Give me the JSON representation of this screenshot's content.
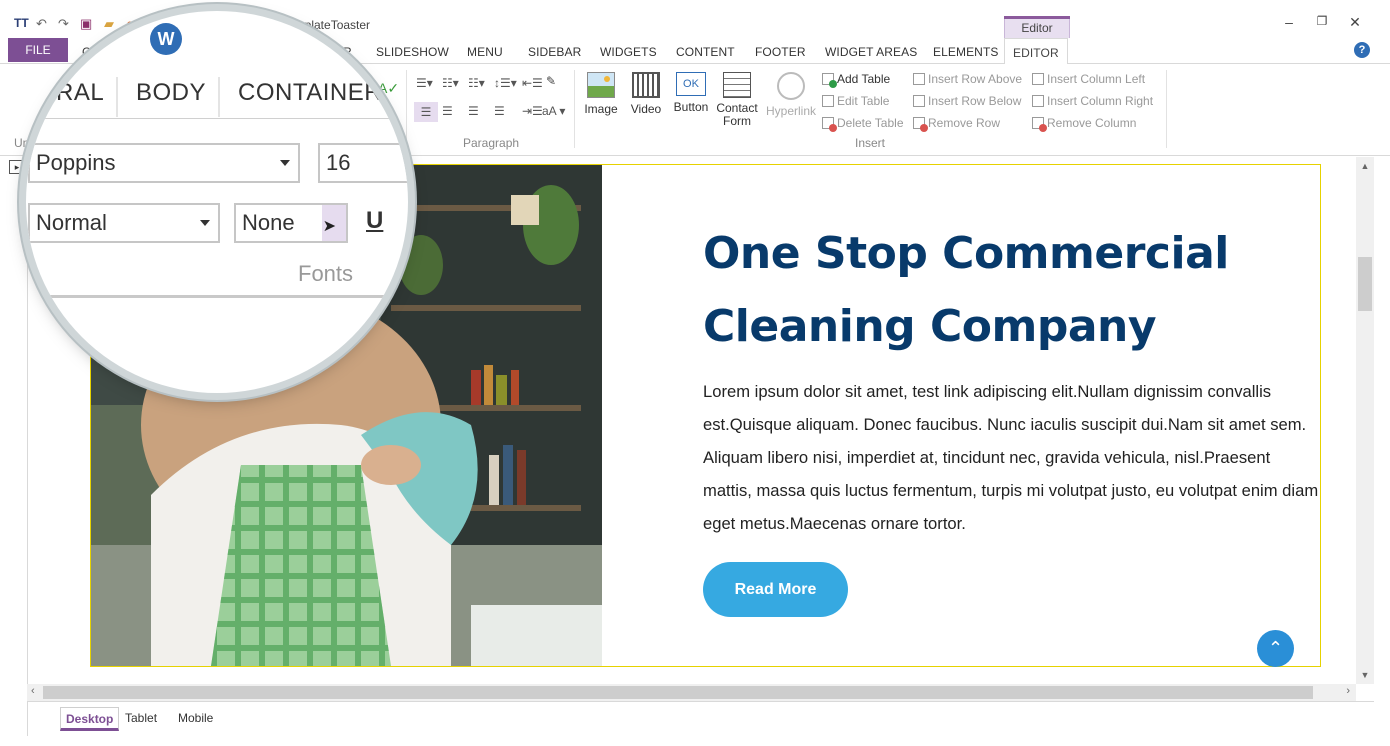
{
  "window": {
    "title": "TemplateToaster",
    "context_tab": "Editor",
    "minimize": "‒",
    "restore": "❐",
    "close": "✕"
  },
  "menu": {
    "file": "FILE",
    "tabs": [
      "GE",
      "HEADER",
      "SLIDESHOW",
      "MENU",
      "SIDEBAR",
      "WIDGETS",
      "CONTENT",
      "FOOTER",
      "WIDGET AREAS",
      "ELEMENTS",
      "EDITOR"
    ],
    "header_partial": "ADER",
    "help": "?"
  },
  "ribbon": {
    "undo_group_label": "Un",
    "paragraph_label": "Paragraph",
    "insert_label": "Insert",
    "font_size_toggle": "aA",
    "image": "Image",
    "video": "Video",
    "button": "Button",
    "button_icon_text": "OK",
    "contact_form_1": "Contact",
    "contact_form_2": "Form",
    "hyperlink": "Hyperlink",
    "add_table": "Add Table",
    "edit_table": "Edit Table",
    "delete_table": "Delete Table",
    "insert_row_above": "Insert Row Above",
    "insert_row_below": "Insert Row Below",
    "remove_row": "Remove Row",
    "insert_column_left": "Insert Column Left",
    "insert_column_right": "Insert Column Right",
    "remove_column": "Remove Column"
  },
  "magnifier": {
    "tab_general": "RAL",
    "tab_body": "BODY",
    "tab_container": "CONTAINER",
    "font_family": "Poppins",
    "font_size": "16",
    "font_weight": "Normal",
    "text_transform": "None",
    "underline": "U",
    "group_label": "Fonts"
  },
  "content": {
    "headline_line1": "One Stop Commercial",
    "headline_line2": "Cleaning Company",
    "paragraph": "Lorem ipsum dolor sit amet, test link adipiscing elit.Nullam dignissim convallis est.Quisque aliquam. Donec faucibus. Nunc iaculis suscipit dui.Nam sit amet sem. Aliquam libero nisi, imperdiet at, tincidunt nec, gravida vehicula, nisl.Praesent mattis, massa quis luctus fermentum, turpis mi volutpat justo, eu volutpat enim diam eget metus.Maecenas ornare tortor.",
    "cta_label": "Read More",
    "to_top": "⌃"
  },
  "devices": {
    "desktop": "Desktop",
    "tablet": "Tablet",
    "mobile": "Mobile"
  },
  "colors": {
    "brand_purple": "#7d4f94",
    "headline_navy": "#083a6b",
    "cta_blue": "#36a9e1",
    "selection_yellow": "#e6d200"
  }
}
